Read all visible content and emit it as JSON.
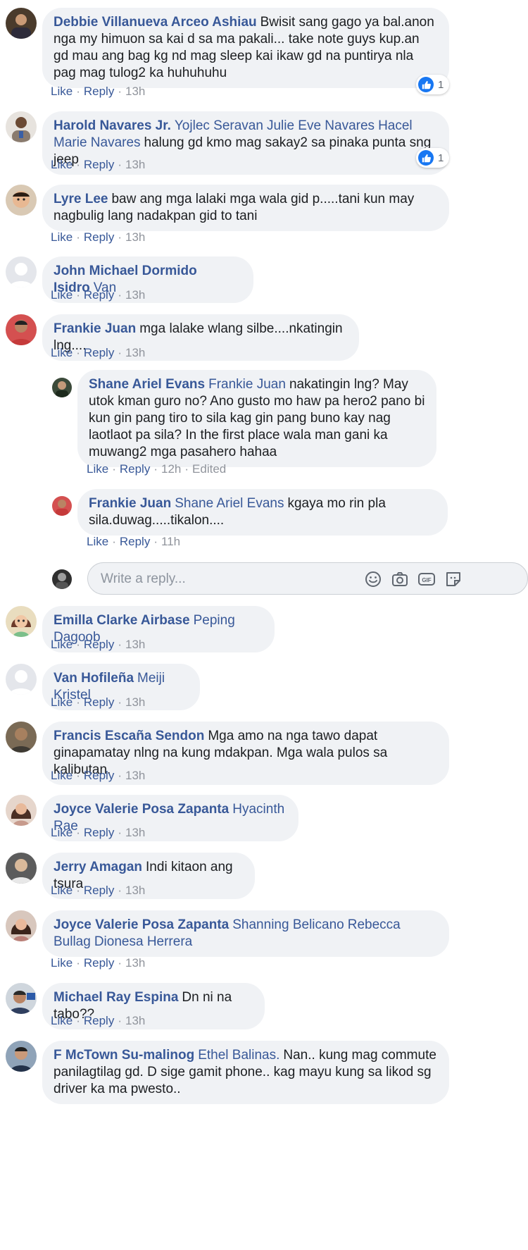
{
  "actions": {
    "like": "Like",
    "reply": "Reply",
    "sep": "·"
  },
  "comments": [
    {
      "name": "Debbie Villanueva Arceo Ashiau",
      "tags": [],
      "text": "Bwisit sang gago ya bal.anon nga my himuon sa kai d sa ma pakali... take note guys kup.an gd mau ang bag kg nd mag sleep kai ikaw gd na puntirya nla pag mag tulog2 ka huhuhuhu",
      "time": "13h",
      "reactions": "1"
    },
    {
      "name": "Harold Navares Jr.",
      "tags": [
        "Yojlec Seravan",
        "Julie Eve Navares",
        "Hacel Marie Navares"
      ],
      "text": "halung gd kmo mag sakay2 sa pinaka punta sng jeep",
      "time": "13h",
      "reactions": "1"
    },
    {
      "name": "Lyre Lee",
      "tags": [],
      "text": "baw ang mga lalaki mga wala gid p.....tani kun may nagbulig lang nadakpan gid to tani",
      "time": "13h"
    },
    {
      "name": "John Michael Dormido Isidro",
      "tags": [
        "Van"
      ],
      "text": "",
      "time": "13h"
    },
    {
      "name": "Frankie Juan",
      "tags": [],
      "text": "mga lalake wlang silbe....nkatingin lng....",
      "time": "13h"
    },
    {
      "name": "Shane Ariel Evans",
      "tags": [
        "Frankie Juan"
      ],
      "text": "nakatingin lng? May utok kman guro no? Ano gusto mo haw pa hero2 pano bi kun gin pang tiro to sila kag gin pang buno kay nag laotlaot pa sila? In the first place wala man gani ka muwang2 mga pasahero hahaa",
      "time": "12h",
      "edited": "Edited"
    },
    {
      "name": "Frankie Juan",
      "tags": [
        "Shane Ariel Evans"
      ],
      "text": "kgaya mo rin pla sila.duwag.....tikalon....",
      "time": "11h"
    },
    {
      "name": "Emilla Clarke Airbase",
      "tags": [
        "Peping Dagoob"
      ],
      "text": "",
      "time": "13h"
    },
    {
      "name": "Van Hofileña",
      "tags": [
        "Meiji Kristel"
      ],
      "text": "",
      "time": "13h"
    },
    {
      "name": "Francis Escaña Sendon",
      "tags": [],
      "text": "Mga amo na nga tawo dapat ginapamatay nlng na kung mdakpan. Mga wala pulos sa kalibutan.",
      "time": "13h"
    },
    {
      "name": "Joyce Valerie Posa Zapanta",
      "tags": [
        "Hyacinth Rae"
      ],
      "text": "",
      "time": "13h"
    },
    {
      "name": "Jerry Amagan",
      "tags": [],
      "text": "Indi kitaon ang tsura",
      "time": "13h"
    },
    {
      "name": "Joyce Valerie Posa Zapanta",
      "tags": [
        "Shanning Belicano",
        "Rebecca Bullag",
        "Dionesa Herrera"
      ],
      "text": "",
      "time": "13h"
    },
    {
      "name": "Michael Ray Espina",
      "tags": [],
      "text": "Dn ni na tabo??",
      "time": "13h"
    },
    {
      "name": "F McTown Su-malinog",
      "tags": [
        "Ethel Balinas."
      ],
      "text": "Nan.. kung mag commute panilagtilag gd. D sige gamit phone.. kag mayu kung sa likod sg driver ka ma pwesto..",
      "time": ""
    }
  ],
  "reply_box": {
    "placeholder": "Write a reply...",
    "icons": [
      "emoji-icon",
      "camera-icon",
      "gif-icon",
      "sticker-icon"
    ]
  },
  "colors": {
    "name_link": "#385898",
    "bubble": "#f0f2f5",
    "meta": "#90949c",
    "like_blue": "#1877f2"
  }
}
